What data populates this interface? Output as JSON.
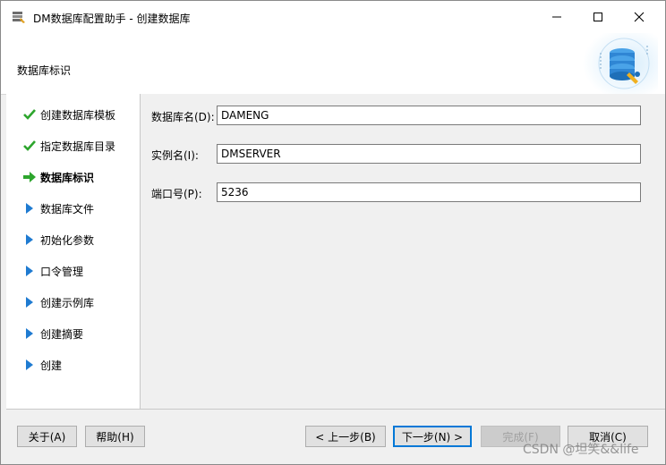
{
  "window": {
    "title": "DM数据库配置助手 - 创建数据库",
    "controls": {
      "minimize": "—",
      "maximize": "☐",
      "close": "✕"
    }
  },
  "header": {
    "title": "数据库标识"
  },
  "sidebar": {
    "items": [
      {
        "label": "创建数据库模板",
        "status": "done",
        "icon": "check-icon"
      },
      {
        "label": "指定数据库目录",
        "status": "done",
        "icon": "check-icon"
      },
      {
        "label": "数据库标识",
        "status": "current",
        "icon": "arrow-right-icon"
      },
      {
        "label": "数据库文件",
        "status": "pending",
        "icon": "triangle-right-icon"
      },
      {
        "label": "初始化参数",
        "status": "pending",
        "icon": "triangle-right-icon"
      },
      {
        "label": "口令管理",
        "status": "pending",
        "icon": "triangle-right-icon"
      },
      {
        "label": "创建示例库",
        "status": "pending",
        "icon": "triangle-right-icon"
      },
      {
        "label": "创建摘要",
        "status": "pending",
        "icon": "triangle-right-icon"
      },
      {
        "label": "创建",
        "status": "pending",
        "icon": "triangle-right-icon"
      }
    ]
  },
  "form": {
    "db_name": {
      "label": "数据库名(D):",
      "value": "DAMENG"
    },
    "instance_name": {
      "label": "实例名(I):",
      "value": "DMSERVER"
    },
    "port": {
      "label": "端口号(P):",
      "value": "5236"
    }
  },
  "footer": {
    "about": "关于(A)",
    "help": "帮助(H)",
    "prev": "< 上一步(B)",
    "next": "下一步(N) >",
    "finish": "完成(F)",
    "cancel": "取消(C)"
  },
  "watermark": "CSDN @坦笑&&life",
  "colors": {
    "check": "#2da52d",
    "arrow": "#2da52d",
    "triangle": "#1f7bd1",
    "primary_border": "#0078d7"
  }
}
